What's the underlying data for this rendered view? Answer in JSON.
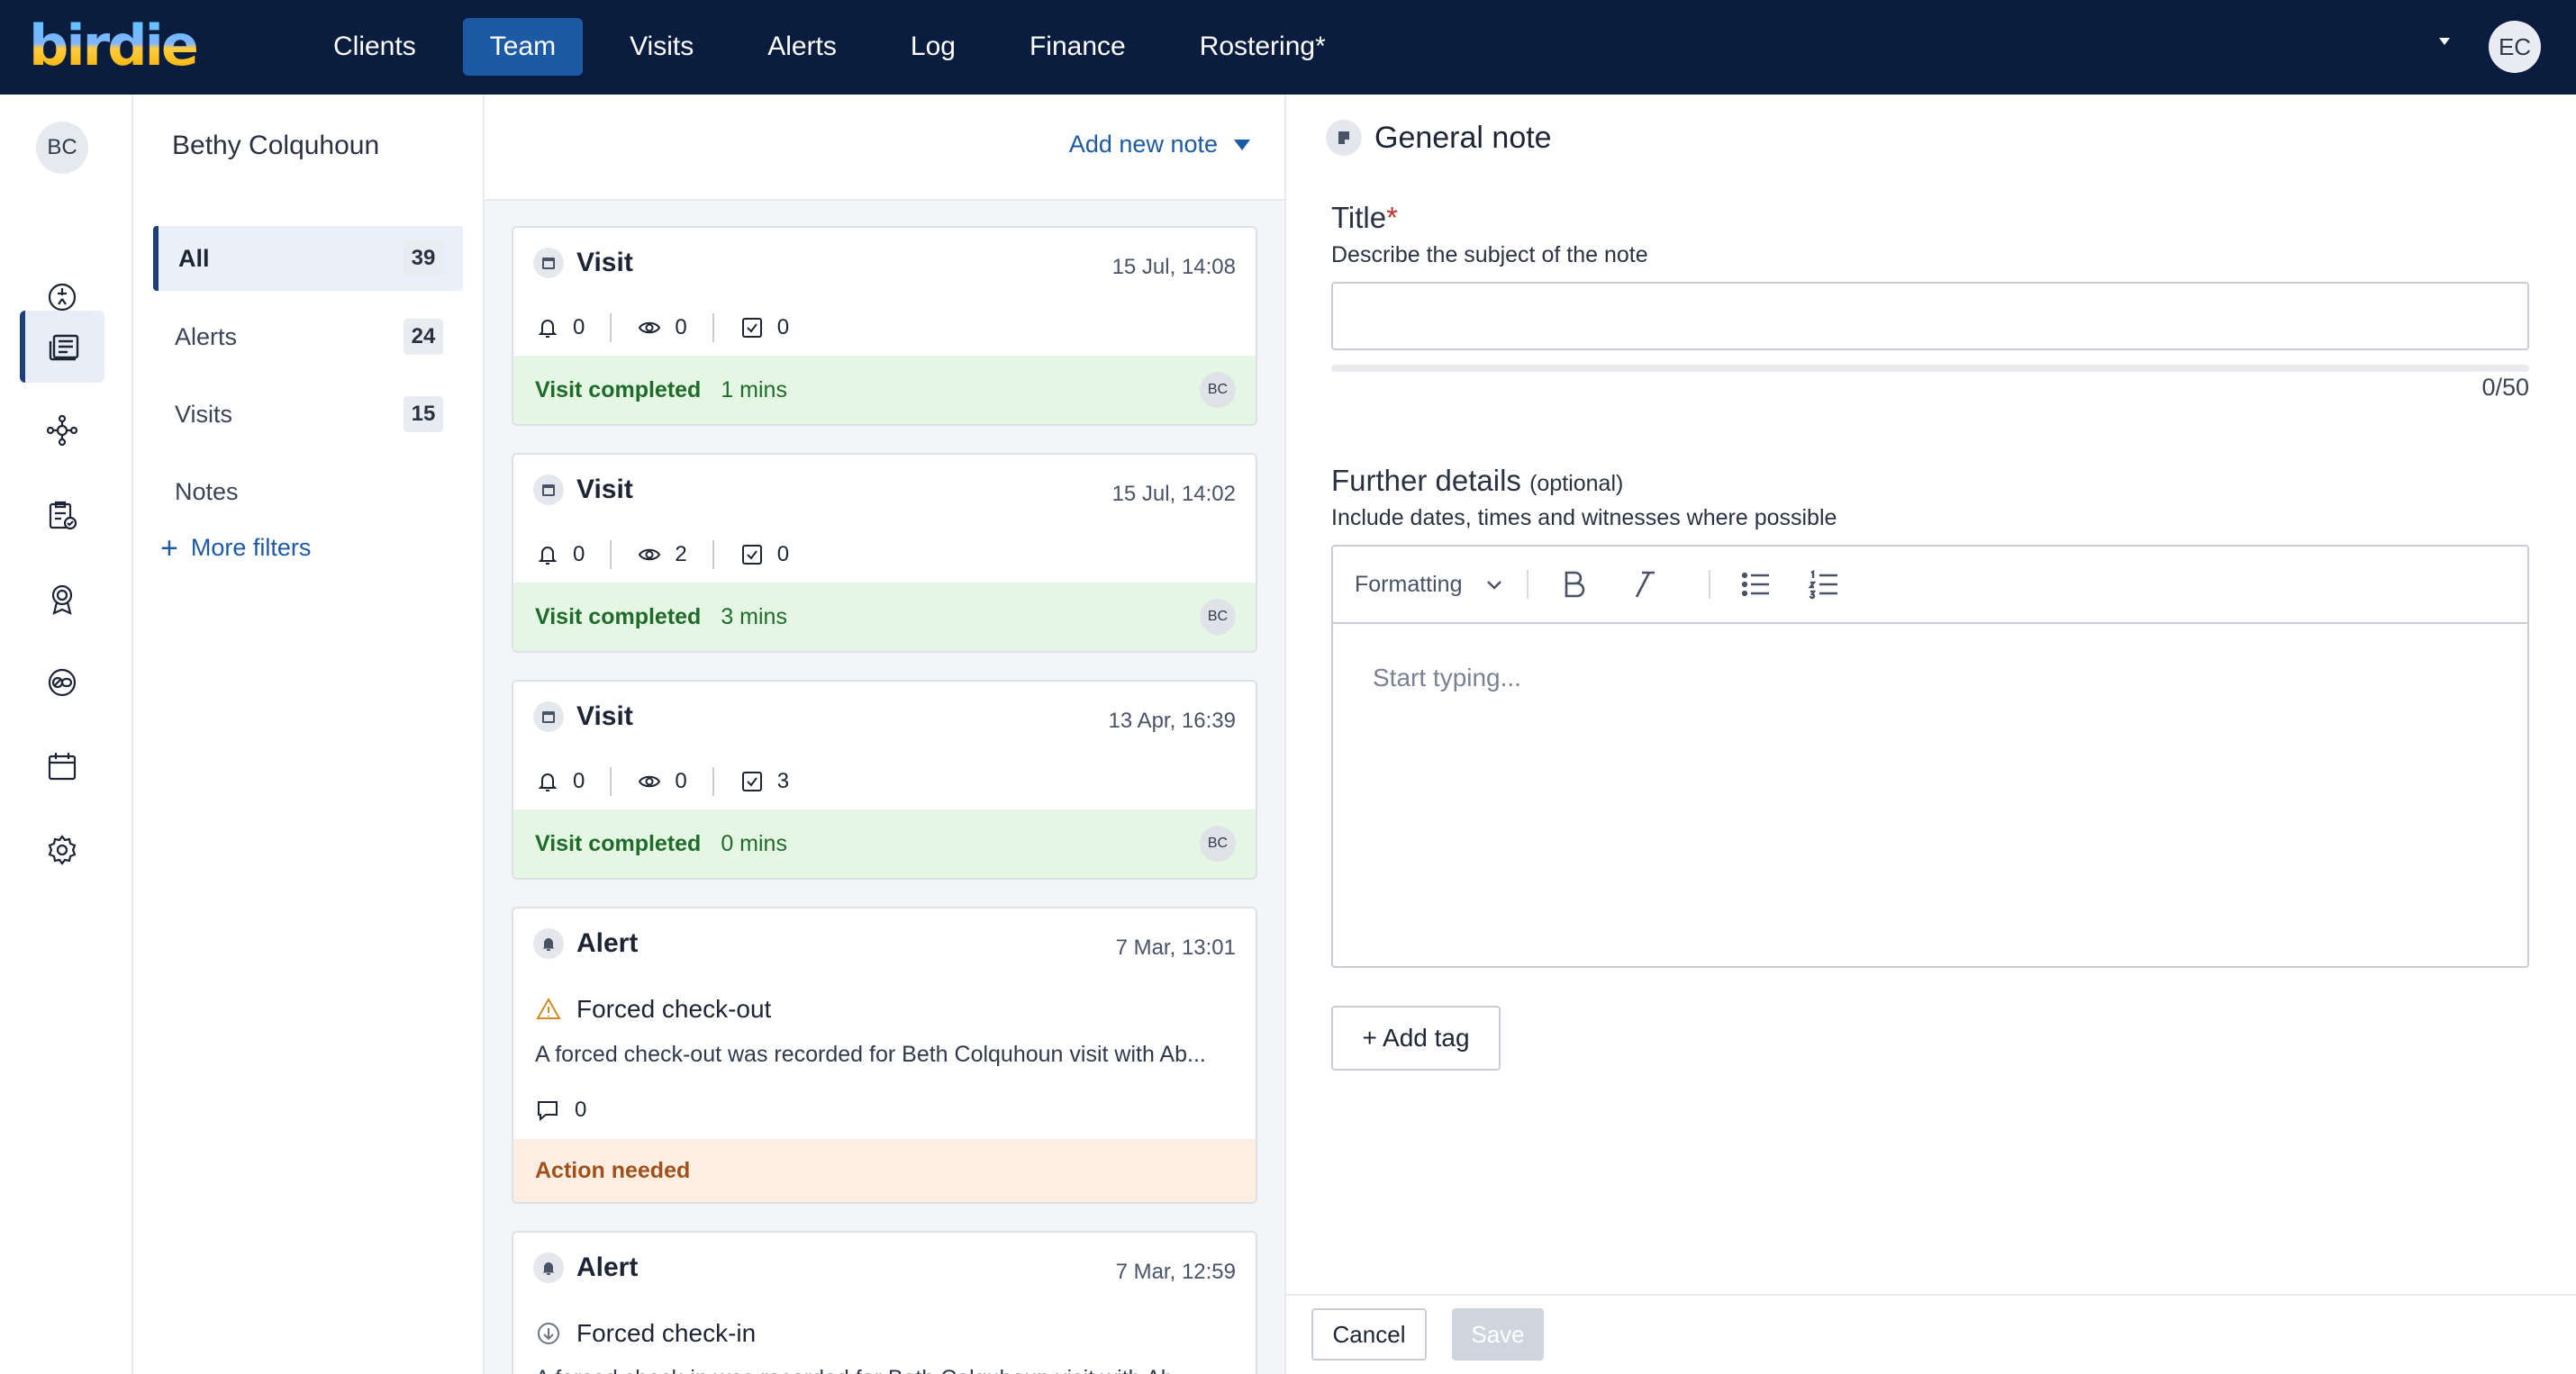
{
  "app": {
    "logo_text": "birdie",
    "user_initials": "EC"
  },
  "nav": {
    "items": [
      "Clients",
      "Team",
      "Visits",
      "Alerts",
      "Log",
      "Finance",
      "Rostering*"
    ],
    "active": "Team"
  },
  "rail": {
    "avatar_initials": "BC",
    "icons": [
      "dashboard-icon",
      "notes-icon",
      "care-plan-icon",
      "tasks-icon",
      "badge-icon",
      "medication-icon",
      "calendar-icon",
      "settings-icon"
    ],
    "active": "notes-icon"
  },
  "filters": {
    "client_name": "Bethy Colquhoun",
    "items": [
      {
        "label": "All",
        "count": "39"
      },
      {
        "label": "Alerts",
        "count": "24"
      },
      {
        "label": "Visits",
        "count": "15"
      },
      {
        "label": "Notes",
        "count": ""
      }
    ],
    "more_filters": "More filters"
  },
  "feed": {
    "add_note_label": "Add new note",
    "visits": [
      {
        "type": "Visit",
        "date": "15 Jul, 14:08",
        "alerts": "0",
        "views": "0",
        "tasks": "0",
        "status": "Visit completed",
        "duration": "1 mins",
        "initials": "BC"
      },
      {
        "type": "Visit",
        "date": "15 Jul, 14:02",
        "alerts": "0",
        "views": "2",
        "tasks": "0",
        "status": "Visit completed",
        "duration": "3 mins",
        "initials": "BC"
      },
      {
        "type": "Visit",
        "date": "13 Apr, 16:39",
        "alerts": "0",
        "views": "0",
        "tasks": "3",
        "status": "Visit completed",
        "duration": "0 mins",
        "initials": "BC"
      }
    ],
    "alerts": [
      {
        "type": "Alert",
        "date": "7 Mar, 13:01",
        "title": "Forced check-out",
        "description": "A forced check-out was recorded for Beth Colquhoun visit with Ab...",
        "comments": "0",
        "status": "Action needed"
      },
      {
        "type": "Alert",
        "date": "7 Mar, 12:59",
        "title": "Forced check-in",
        "description": "A forced check-in was recorded for Beth Colquhoun visit with Ab..."
      }
    ]
  },
  "note_form": {
    "header": "General note",
    "title_label": "Title",
    "title_required": "*",
    "title_hint": "Describe the subject of the note",
    "title_value": "",
    "counter": "0/50",
    "details_label": "Further details",
    "details_optional": "(optional)",
    "details_hint": "Include dates, times and witnesses where possible",
    "formatting_label": "Formatting",
    "editor_placeholder": "Start typing...",
    "add_tag": "+ Add tag",
    "cancel": "Cancel",
    "save": "Save"
  }
}
